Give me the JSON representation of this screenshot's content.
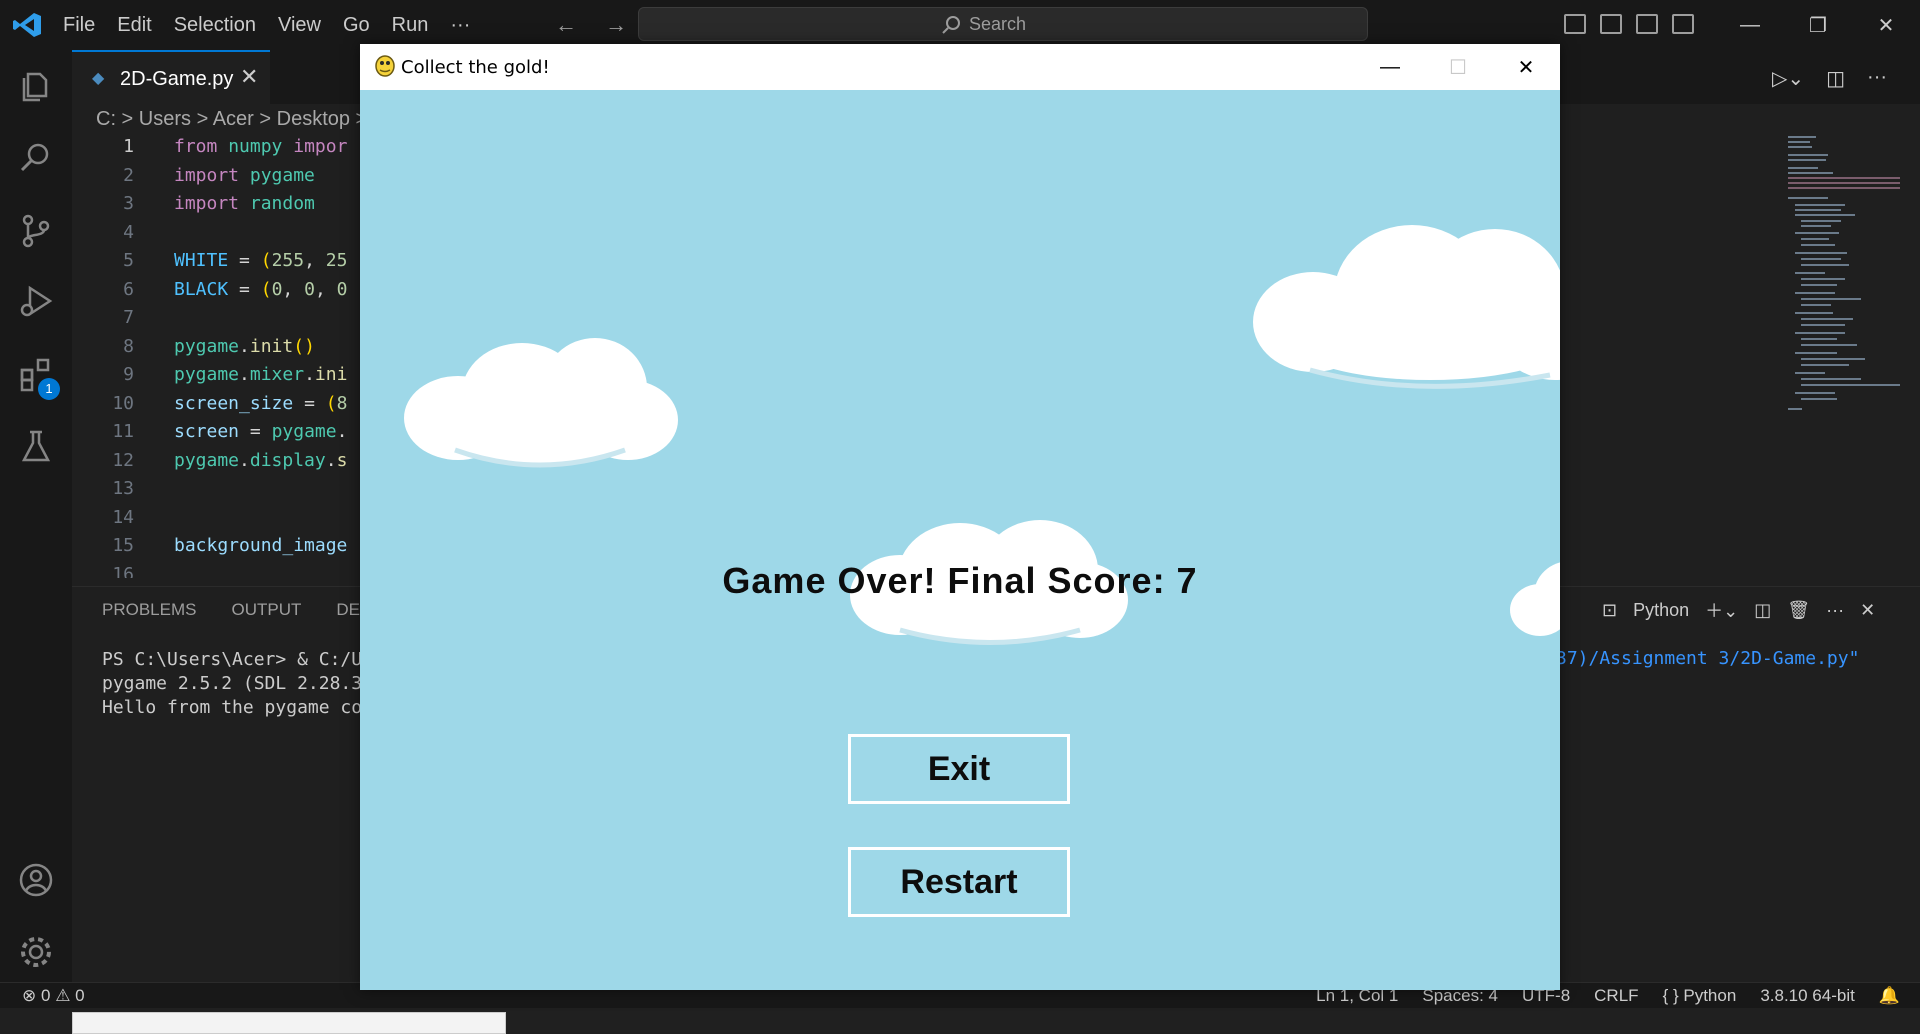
{
  "menu": [
    "File",
    "Edit",
    "Selection",
    "View",
    "Go",
    "Run",
    "···"
  ],
  "search": {
    "placeholder": "Search"
  },
  "tab": {
    "label": "2D-Game.py",
    "close": "✕"
  },
  "breadcrumb": "C: > Users > Acer > Desktop >",
  "code_lines": [
    {
      "n": "1",
      "text": "from numpy impor"
    },
    {
      "n": "2",
      "text": "import pygame"
    },
    {
      "n": "3",
      "text": "import random"
    },
    {
      "n": "4",
      "text": ""
    },
    {
      "n": "5",
      "text": "WHITE = (255, 25"
    },
    {
      "n": "6",
      "text": "BLACK = (0, 0, 0"
    },
    {
      "n": "7",
      "text": ""
    },
    {
      "n": "8",
      "text": "pygame.init()"
    },
    {
      "n": "9",
      "text": "pygame.mixer.ini"
    },
    {
      "n": "10",
      "text": "screen_size = (8"
    },
    {
      "n": "11",
      "text": "screen = pygame."
    },
    {
      "n": "12",
      "text": "pygame.display.s"
    },
    {
      "n": "13",
      "text": ""
    },
    {
      "n": "14",
      "text": ""
    },
    {
      "n": "15",
      "text": "background_image"
    },
    {
      "n": "16",
      "text": ""
    }
  ],
  "panel": {
    "tabs": [
      "PROBLEMS",
      "OUTPUT",
      "DEBU"
    ],
    "terminal_lines": [
      "PS C:\\Users\\Acer> & C:/U",
      "pygame 2.5.2 (SDL 2.28.3",
      "Hello from the pygame co"
    ],
    "terminal_right": "37)/Assignment 3/2D-Game.py\"",
    "shell_label": "Python"
  },
  "activity_badge": "1",
  "status": {
    "errors": "0",
    "warnings": "0",
    "position": "Ln 1, Col 1",
    "spaces": "Spaces: 4",
    "encoding": "UTF-8",
    "eol": "CRLF",
    "language": "Python",
    "interpreter": "3.8.10 64-bit"
  },
  "game": {
    "window_title": "Collect the gold!",
    "score_text": "Game Over! Final Score: 7",
    "exit_label": "Exit",
    "restart_label": "Restart"
  },
  "colors": {
    "sky": "#9ed8e8",
    "accent": "#0078d4"
  }
}
